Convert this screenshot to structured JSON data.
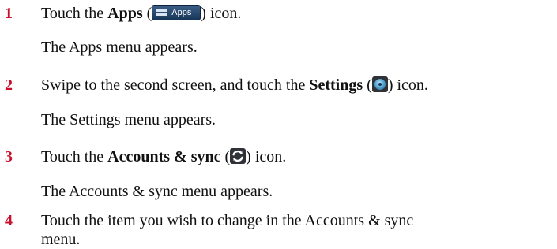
{
  "steps": [
    {
      "number": "1",
      "pre": "Touch the ",
      "bold": "Apps",
      "paren_open": " (",
      "icon_name": "apps-icon",
      "icon_label": "Apps",
      "post": ") icon.",
      "result": "The Apps menu appears."
    },
    {
      "number": "2",
      "pre": "Swipe to the second screen, and touch the ",
      "bold": "Settings",
      "paren_open": " (",
      "icon_name": "settings-icon",
      "post": ") icon.",
      "result": "The Settings menu appears."
    },
    {
      "number": "3",
      "pre": "Touch the ",
      "bold": "Accounts & sync",
      "paren_open": " (",
      "icon_name": "sync-icon",
      "post": ") icon.",
      "result": "The Accounts & sync menu appears."
    },
    {
      "number": "4",
      "text": "Touch the item you wish to change in the Accounts & sync menu."
    }
  ],
  "colors": {
    "step_number": "#c8102e",
    "text": "#111111"
  }
}
